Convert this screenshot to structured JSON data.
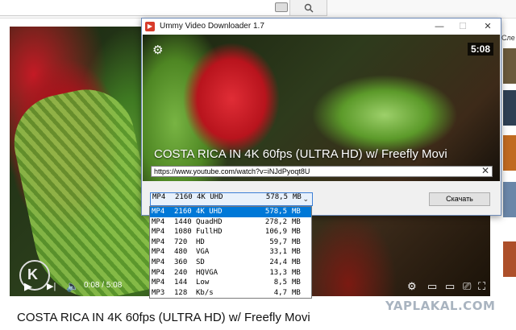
{
  "browser": {
    "search_icon": "search-icon",
    "keyboard_icon": "keyboard-icon"
  },
  "youtube": {
    "video_title": "COSTA RICA IN 4K 60fps (ULTRA HD) w/ Freefly Movi",
    "current_time": "0:08 / 5:08",
    "progress": 0.026,
    "sidebar_label": "Сле",
    "watermark": "YAPLAKAL.COM"
  },
  "app": {
    "title": "Ummy Video Downloader 1.7",
    "duration": "5:08",
    "video_title": "COSTA RICA IN 4K 60fps (ULTRA HD) w/ Freefly Movi",
    "url": "https://www.youtube.com/watch?v=iNJdPyoqt8U",
    "download_label": "Скачать",
    "selected": {
      "format": "MP4",
      "res": "2160",
      "label": "4K UHD",
      "size": "578,5",
      "unit": "MB"
    },
    "options": [
      {
        "format": "MP4",
        "res": "2160",
        "label": "4K UHD",
        "size": "578,5",
        "unit": "MB"
      },
      {
        "format": "MP4",
        "res": "1440",
        "label": "QuadHD",
        "size": "278,2",
        "unit": "MB"
      },
      {
        "format": "MP4",
        "res": "1080",
        "label": "FullHD",
        "size": "106,9",
        "unit": "MB"
      },
      {
        "format": "MP4",
        "res": "720",
        "label": "HD",
        "size": "59,7",
        "unit": "MB"
      },
      {
        "format": "MP4",
        "res": "480",
        "label": "VGA",
        "size": "33,1",
        "unit": "MB"
      },
      {
        "format": "MP4",
        "res": "360",
        "label": "SD",
        "size": "24,4",
        "unit": "MB"
      },
      {
        "format": "MP4",
        "res": "240",
        "label": "HQVGA",
        "size": "13,3",
        "unit": "MB"
      },
      {
        "format": "MP4",
        "res": "144",
        "label": "Low",
        "size": "8,5",
        "unit": "MB"
      },
      {
        "format": "MP3",
        "res": "128",
        "label": "Kb/s",
        "size": "4,7",
        "unit": "MB"
      }
    ]
  }
}
